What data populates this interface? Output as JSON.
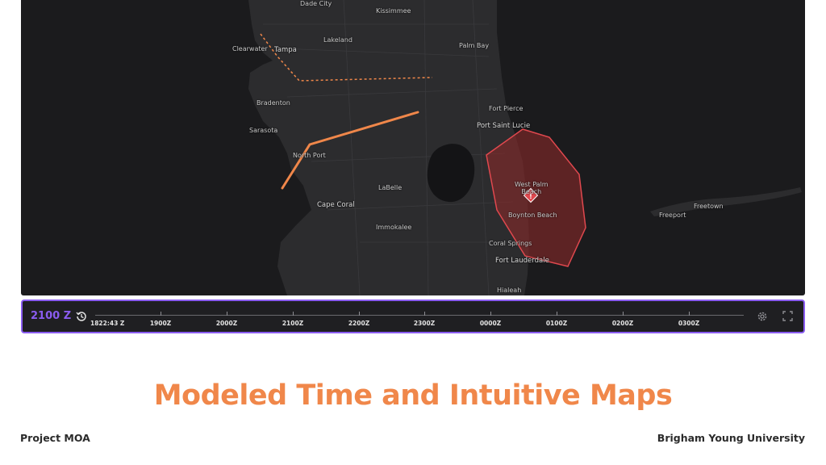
{
  "map": {
    "cities": [
      {
        "id": "dade-city",
        "name": "Dade City"
      },
      {
        "id": "kissimmee",
        "name": "Kissimmee"
      },
      {
        "id": "clearwater",
        "name": "Clearwater"
      },
      {
        "id": "tampa",
        "name": "Tampa"
      },
      {
        "id": "lakeland",
        "name": "Lakeland"
      },
      {
        "id": "palm-bay",
        "name": "Palm Bay"
      },
      {
        "id": "bradenton",
        "name": "Bradenton"
      },
      {
        "id": "sarasota",
        "name": "Sarasota"
      },
      {
        "id": "fort-pierce",
        "name": "Fort Pierce"
      },
      {
        "id": "port-saint-lucie",
        "name": "Port Saint Lucie"
      },
      {
        "id": "north-port",
        "name": "North Port"
      },
      {
        "id": "west-palm-beach",
        "name": "West Palm\nBeach"
      },
      {
        "id": "labelle",
        "name": "LaBelle"
      },
      {
        "id": "cape-coral",
        "name": "Cape Coral"
      },
      {
        "id": "boynton-beach",
        "name": "Boynton Beach"
      },
      {
        "id": "immokalee",
        "name": "Immokalee"
      },
      {
        "id": "freetown",
        "name": "Freetown"
      },
      {
        "id": "freeport",
        "name": "Freeport"
      },
      {
        "id": "coral-springs",
        "name": "Coral Springs"
      },
      {
        "id": "fort-lauderdale",
        "name": "Fort Lauderdale"
      },
      {
        "id": "hialeah",
        "name": "Hialeah"
      }
    ],
    "colors": {
      "route": "#f0874a",
      "hazard_fill": "#8b2a2a",
      "hazard_stroke": "#e0484e"
    }
  },
  "timebar": {
    "current_time": "2100 Z",
    "start_label": "1822:43 Z",
    "ticks": [
      "1900Z",
      "2000Z",
      "2100Z",
      "2200Z",
      "2300Z",
      "0000Z",
      "0100Z",
      "0200Z",
      "0300Z"
    ],
    "accent": "#8a5cf0"
  },
  "slide": {
    "title": "Modeled Time and Intuitive Maps",
    "footer_left": "Project MOA",
    "footer_right": "Brigham Young University",
    "title_color": "#f0874a"
  }
}
